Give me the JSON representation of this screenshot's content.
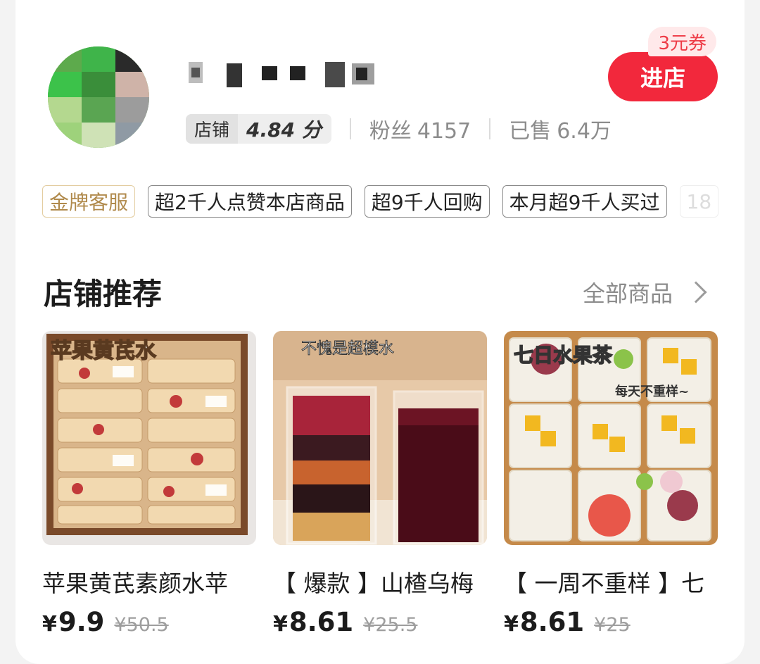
{
  "shop": {
    "score_label": "店铺",
    "score_value": "4.84 分",
    "fans_label": "粉丝",
    "fans_value": "4157",
    "sold_label": "已售",
    "sold_value": "6.4万",
    "coupon": "3元券",
    "enter_label": "进店",
    "avatar_icon": "blurred-avatar",
    "name_icon": "pixelated-shop-name"
  },
  "tags": [
    "金牌客服",
    "超2千人点赞本店商品",
    "超9千人回购",
    "本月超9千人买过",
    "18"
  ],
  "section": {
    "title": "店铺推荐",
    "all_label": "全部商品"
  },
  "products": [
    {
      "image_text": "苹果黄芪水",
      "title": "苹果黄芪素颜水苹",
      "price": "9.9",
      "original": "¥50.5"
    },
    {
      "image_text": "不愧是超模水",
      "title": "【 爆款 】山楂乌梅",
      "price": "8.61",
      "original": "¥25.5"
    },
    {
      "image_text": "七日水果茶",
      "image_subtext": "每天不重样~",
      "title": "【 一周不重样 】七",
      "price": "8.61",
      "original": "¥25"
    }
  ],
  "currency": "¥",
  "colors": {
    "accent": "#f2283c",
    "coupon_bg": "#ffe9ea",
    "gold_tag": "#b08a4c"
  }
}
